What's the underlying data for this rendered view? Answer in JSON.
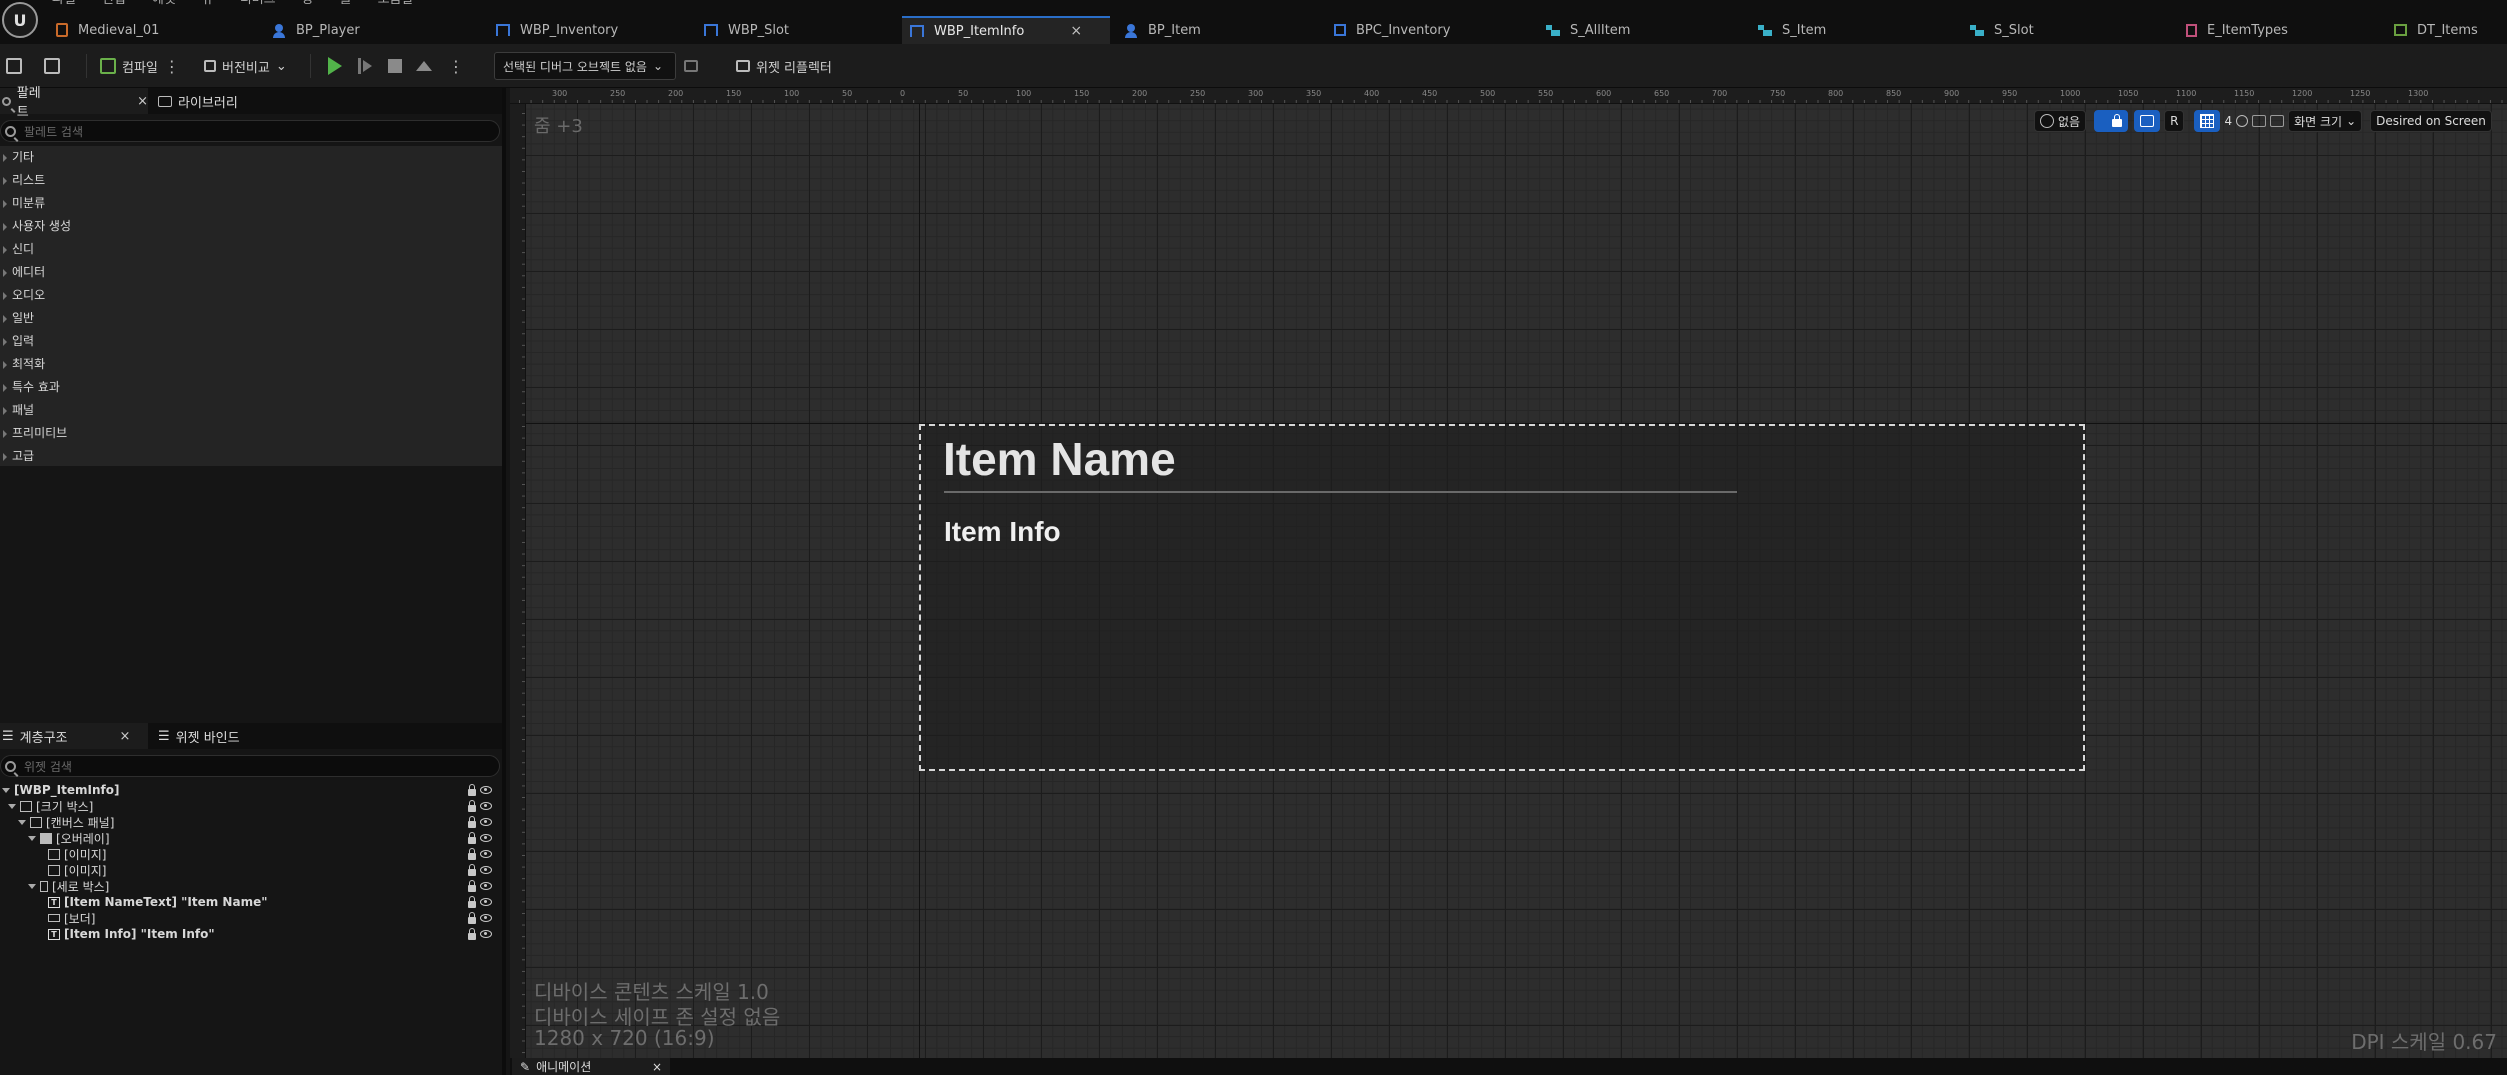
{
  "app": {
    "menu": [
      "파일",
      "편집",
      "에셋",
      "뷰",
      "디버그",
      "창",
      "툴",
      "도움말"
    ],
    "tabs": [
      {
        "label": "Medieval_01",
        "icon": "level-icon"
      },
      {
        "label": "BP_Player",
        "icon": "pawn-icon"
      },
      {
        "label": "WBP_Inventory",
        "icon": "widget-blueprint-icon"
      },
      {
        "label": "WBP_Slot",
        "icon": "widget-blueprint-icon"
      },
      {
        "label": "WBP_ItemInfo",
        "icon": "widget-blueprint-icon",
        "active": true
      },
      {
        "label": "BP_Item",
        "icon": "pawn-icon"
      },
      {
        "label": "BPC_Inventory",
        "icon": "component-icon"
      },
      {
        "label": "S_AllItem",
        "icon": "struct-icon"
      },
      {
        "label": "S_Item",
        "icon": "struct-icon"
      },
      {
        "label": "S_Slot",
        "icon": "struct-icon"
      },
      {
        "label": "E_ItemTypes",
        "icon": "enum-icon"
      },
      {
        "label": "DT_Items",
        "icon": "datatable-icon"
      }
    ],
    "tab_close": "×"
  },
  "toolbar": {
    "compile": "컴파일",
    "diff": "버전비교",
    "debug_object": "선택된 디버그 오브젝트 없음",
    "widget_reflector": "위젯 리플렉터"
  },
  "palette": {
    "tab": "팔레트",
    "library_tab": "라이브러리",
    "close": "×",
    "search_placeholder": "팔레트 검색",
    "categories": [
      "기타",
      "리스트",
      "미분류",
      "사용자 생성",
      "신디",
      "에디터",
      "오디오",
      "일반",
      "입력",
      "최적화",
      "특수 효과",
      "패널",
      "프리미티브",
      "고급"
    ]
  },
  "hierarchy": {
    "tab": "계층구조",
    "bindings_tab": "위젯 바인드",
    "close": "×",
    "search_placeholder": "위젯 검색",
    "rows": [
      {
        "label": "[WBP_ItemInfo]",
        "indent": 0,
        "icon": "",
        "arrow": true,
        "bold": true
      },
      {
        "label": "[크기 박스]",
        "indent": 1,
        "icon": "sizebox",
        "arrow": true,
        "bold": false
      },
      {
        "label": "[캔버스 패널]",
        "indent": 2,
        "icon": "canvas",
        "arrow": true,
        "bold": false
      },
      {
        "label": "[오버레이]",
        "indent": 3,
        "icon": "overlay",
        "arrow": true,
        "bold": false
      },
      {
        "label": "[이미지]",
        "indent": 4,
        "icon": "image",
        "arrow": false,
        "bold": false
      },
      {
        "label": "[이미지]",
        "indent": 4,
        "icon": "image",
        "arrow": false,
        "bold": false
      },
      {
        "label": "[세로 박스]",
        "indent": 3,
        "icon": "vbox",
        "arrow": true,
        "bold": false
      },
      {
        "label": "[Item NameText] \"Item Name\"",
        "indent": 4,
        "icon": "text",
        "arrow": false,
        "bold": true
      },
      {
        "label": "[보더]",
        "indent": 4,
        "icon": "border",
        "arrow": false,
        "bold": false
      },
      {
        "label": "[Item Info] \"Item Info\"",
        "indent": 4,
        "icon": "text",
        "arrow": false,
        "bold": true
      }
    ]
  },
  "designer": {
    "zoom": "줌 +3",
    "ruler_labels": [
      "300",
      "250",
      "200",
      "150",
      "100",
      "50",
      "0",
      "50",
      "100",
      "150",
      "200",
      "250",
      "300",
      "350",
      "400",
      "450",
      "500",
      "550",
      "600",
      "650",
      "700",
      "750",
      "800",
      "850",
      "900",
      "950",
      "1000",
      "1050",
      "1100",
      "1150",
      "1200",
      "1250",
      "1300"
    ],
    "localization": "없음",
    "grid_snap": "4",
    "screen_size": "화면 크기",
    "fill_mode": "Desired on Screen",
    "r_label": "R",
    "widget": {
      "title": "Item Name",
      "info": "Item Info"
    },
    "device_scale": "디바이스 콘텐츠 스케일 1.0",
    "safe_zone": "디바이스 세이프 존 설정 없음",
    "resolution": "1280 x 720 (16:9)",
    "dpi": "DPI 스케일 0.67"
  },
  "bottom": {
    "animation_tab": "애니메이션",
    "close": "×"
  }
}
